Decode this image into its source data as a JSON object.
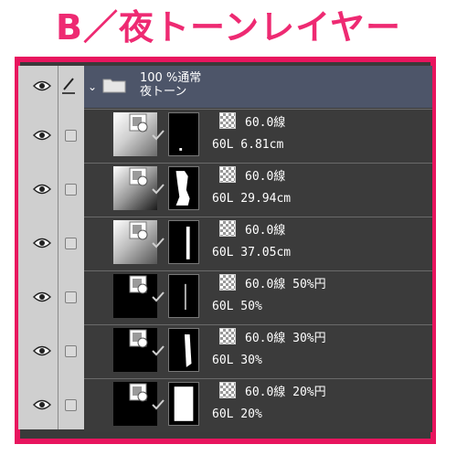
{
  "title": "B／夜トーンレイヤー",
  "folder": {
    "opacity_mode": "100 %通常",
    "name": "夜トーン"
  },
  "layers": [
    {
      "line1": "60.0線",
      "line2": "60L 6.81cm"
    },
    {
      "line1": "60.0線",
      "line2": "60L 29.94cm"
    },
    {
      "line1": "60.0線",
      "line2": "60L 37.05cm"
    },
    {
      "line1": "60.0線 50%円",
      "line2": "60L 50%"
    },
    {
      "line1": "60.0線 30%円",
      "line2": "60L 30%"
    },
    {
      "line1": "60.0線 20%円",
      "line2": "60L 20%"
    }
  ],
  "icons": [
    "eye-icon",
    "pen-icon",
    "folder-icon",
    "tone-icon",
    "checkmark-icon"
  ],
  "colors": {
    "accent": "#e8155e",
    "title": "#ee2a72",
    "panel": "#3b3b3b",
    "folder_row": "#4d5569"
  }
}
